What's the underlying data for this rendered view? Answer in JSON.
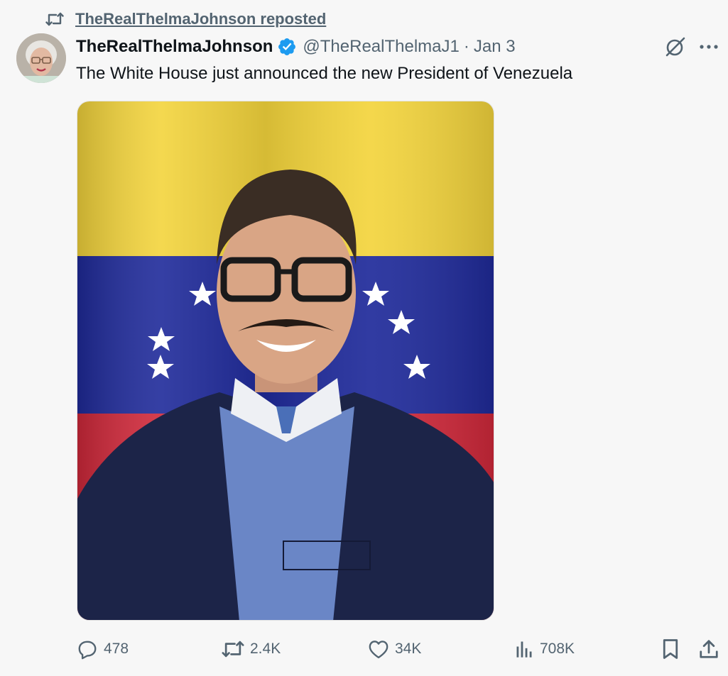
{
  "repost": {
    "label": "TheRealThelmaJohnson reposted",
    "icon": "repost-icon"
  },
  "author": {
    "display_name": "TheRealThelmaJohnson",
    "handle": "@TheRealThelmaJ1",
    "separator": "·",
    "date": "Jan 3",
    "verified": true,
    "verified_color": "#1d9bf0"
  },
  "tweet": {
    "text": "The White House just announced the new President of Venezuela"
  },
  "media": {
    "flag_colors": {
      "yellow": "#f3d43c",
      "blue": "#1f2a9a",
      "red": "#d0283a"
    }
  },
  "actions": {
    "replies": "478",
    "reposts": "2.4K",
    "likes": "34K",
    "views": "708K"
  },
  "icons": {
    "more": "more-icon",
    "grok": "grok-icon",
    "bookmark": "bookmark-icon",
    "share": "share-icon"
  },
  "colors": {
    "background": "#f7f7f7",
    "text": "#0f1419",
    "secondary": "#536471"
  }
}
